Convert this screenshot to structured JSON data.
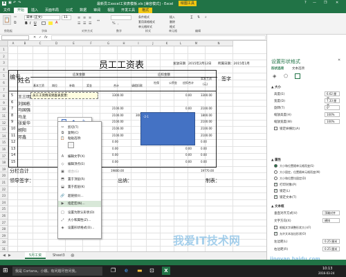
{
  "title_bar": {
    "filename": "最新员工excel工资表模板.xls [兼容模式] - Excel",
    "tool_context": "绘图工具",
    "help": "?",
    "min": "—",
    "restore": "❐",
    "close": "✕"
  },
  "tabs": [
    "文件",
    "开始",
    "插入",
    "页面布局",
    "公式",
    "数据",
    "审阅",
    "视图",
    "开发工具",
    "格式"
  ],
  "ribbon": {
    "font_name": "宋体 (正文)",
    "font_size": "11",
    "groups": [
      "剪贴板",
      "字体",
      "对齐方式",
      "数字",
      "样式",
      "单元格",
      "编辑"
    ],
    "cond_format": "条件格式",
    "table_format": "套用表格格式",
    "cell_style": "单元格样式",
    "insert": "插入",
    "delete": "删除",
    "format": "格式"
  },
  "formula_bar": {
    "namebox": "",
    "fx": "fx"
  },
  "columns": [
    "A",
    "B",
    "C",
    "D",
    "E",
    "F",
    "G",
    "H",
    "I",
    "J",
    "K",
    "L",
    "M",
    "N"
  ],
  "rows": [
    "1",
    "2",
    "3",
    "4",
    "5",
    "6",
    "7",
    "8",
    "9",
    "10",
    "11",
    "12",
    "13",
    "14",
    "15",
    "16",
    "17",
    "18",
    "19",
    "20",
    "21",
    "22",
    "23",
    "24",
    "25",
    "26",
    "27",
    "28",
    "29",
    "30",
    "31"
  ],
  "sheet": {
    "title": "员工工资表",
    "issue_date_label": "发放日期",
    "issue_date": "2015年2月12日",
    "period": "所属日期：2015年1月",
    "col_no": "编号",
    "col_name": "姓名",
    "group_payable": "应发金额",
    "group_deduct": "应扣金额",
    "col_basic": "基本工资",
    "col_post": "岗位",
    "col_subsidy": "补助",
    "col_bonus": "奖金",
    "col_total": "合计",
    "col_overtime": "请假扣款",
    "col_social": "社保",
    "col_fund": "公积金",
    "col_deduct_total": "应扣合计",
    "col_actual": "实发工资",
    "col_actual_unit": "(元)",
    "col_sign": "签字",
    "rows": [
      {
        "name": "王三明",
        "total": "3300.00",
        "deduct": "0.00",
        "actual": "3300.00"
      },
      {
        "name": "刘国栋",
        "total": "",
        "deduct": "",
        "actual": ""
      },
      {
        "name": "马国强",
        "total": "2100.00",
        "deduct": "0.00",
        "actual": "2100.00"
      },
      {
        "name": "马龙",
        "total": "2100.00",
        "overtime": "300.00",
        "deduct": "300.00",
        "actual": "1800.00"
      },
      {
        "name": "张爱华",
        "total": "2100.00",
        "deduct": "0.00",
        "actual": "2100.00"
      },
      {
        "name": "胡阳",
        "total": "2100.00",
        "deduct": "0.00",
        "actual": "2100.00"
      },
      {
        "name": "邓鑫",
        "total": "2100.00",
        "deduct": "0.00",
        "actual": "2100.00"
      },
      {
        "name": "",
        "total": "0.00",
        "deduct": "0.00",
        "actual": "0.00"
      },
      {
        "name": "",
        "total": "0.00",
        "deduct": "0.00",
        "actual": "0.00"
      },
      {
        "name": "",
        "total": "0.00",
        "deduct": "0.00",
        "actual": "0.00"
      },
      {
        "name": "",
        "total": "0.00",
        "deduct": "0.00",
        "actual": "0.00"
      }
    ],
    "subtotal_label": "分栏合计",
    "subtotal_total": "19800.00",
    "subtotal_deduct": "",
    "subtotal_actual": "19770.00",
    "leader_sign": "领导签字：",
    "cashier": "出纳：",
    "preparer": "制表："
  },
  "comment_text": "员工工资情况调查表反馈：",
  "shape_text": "-2-1",
  "mini_toolbar": {
    "style": "样式",
    "fill": "填充",
    "outline": "轮廓"
  },
  "context_menu": {
    "items": [
      {
        "label": "剪切(T)",
        "icon": "scissors-icon",
        "disabled": false
      },
      {
        "label": "复制(C)",
        "icon": "copy-icon",
        "disabled": false
      },
      {
        "label": "粘贴选项:",
        "icon": "paste-icon",
        "disabled": false
      },
      {
        "label": "编辑文字(X)",
        "icon": "text-icon",
        "disabled": false
      },
      {
        "label": "编辑顶点(E)",
        "icon": "points-icon",
        "disabled": false
      },
      {
        "label": "组合(G)",
        "icon": "group-icon",
        "disabled": true
      },
      {
        "label": "置于顶层(R)",
        "icon": "front-icon",
        "disabled": false
      },
      {
        "label": "置于底层(K)",
        "icon": "back-icon",
        "disabled": false
      },
      {
        "label": "超链接(I)...",
        "icon": "link-icon",
        "disabled": false
      },
      {
        "label": "指定宏(N)...",
        "icon": "macro-icon",
        "disabled": false
      },
      {
        "label": "设置为默认形状(D)",
        "icon": "default-icon",
        "disabled": false
      },
      {
        "label": "大小和属性(Z)...",
        "icon": "size-icon",
        "disabled": false
      },
      {
        "label": "设置形状格式(O)...",
        "icon": "format-icon",
        "disabled": false
      }
    ]
  },
  "panel": {
    "title": "设置形状格式",
    "tab_shape": "形状选项",
    "tab_text": "文本选项",
    "section_size": "▲ 大小",
    "height_label": "高度(E)",
    "height_value": "6.62 厘米",
    "width_label": "宽度(D)",
    "width_value": "7.33 厘米",
    "rotate_label": "旋转(T)",
    "rotate_value": "0°",
    "scale_h_label": "缩放高度(H)",
    "scale_h_value": "100%",
    "scale_w_label": "缩放宽度(W)",
    "scale_w_value": "100%",
    "lock_ratio": "锁定纵横比(A)",
    "section_props": "▲ 属性",
    "prop1": "大小和位置随单元格而变(S)",
    "prop2": "大小固定，位置随单元格而变(M)",
    "prop3": "大小和位置均固定(D)",
    "print_obj": "打印对象(P)",
    "locked": "锁定(L)",
    "lock_text": "锁定文本(T)",
    "section_textbox": "▲ 文本框",
    "valign_label": "垂直对齐方式(V)",
    "valign_value": "顶端对齐",
    "direction_label": "文字方向(X)",
    "direction_value": "横排",
    "autofit": "根据文字调整形状大小(F)",
    "overflow": "允许文本溢出形状(O)",
    "margin_left_label": "左边距(L)",
    "margin_left_value": "0.25 厘米",
    "margin_right_label": "右边距(R)",
    "margin_right_value": "0.25 厘米"
  },
  "sheet_tabs": [
    "5月工资",
    "Sheet3"
  ],
  "add_sheet": "⊕",
  "taskbar": {
    "search": "我是 Cortana，小娜。有问题尽管问我。",
    "time": "10:13",
    "date": "2016-03-24"
  },
  "watermark": {
    "main": "我爱IT技术网",
    "sub": "jingyan.baidu.com"
  },
  "colors": {
    "excel_green": "#217346",
    "shape_blue": "#4472c4",
    "tool_yellow": "#f2c811"
  }
}
